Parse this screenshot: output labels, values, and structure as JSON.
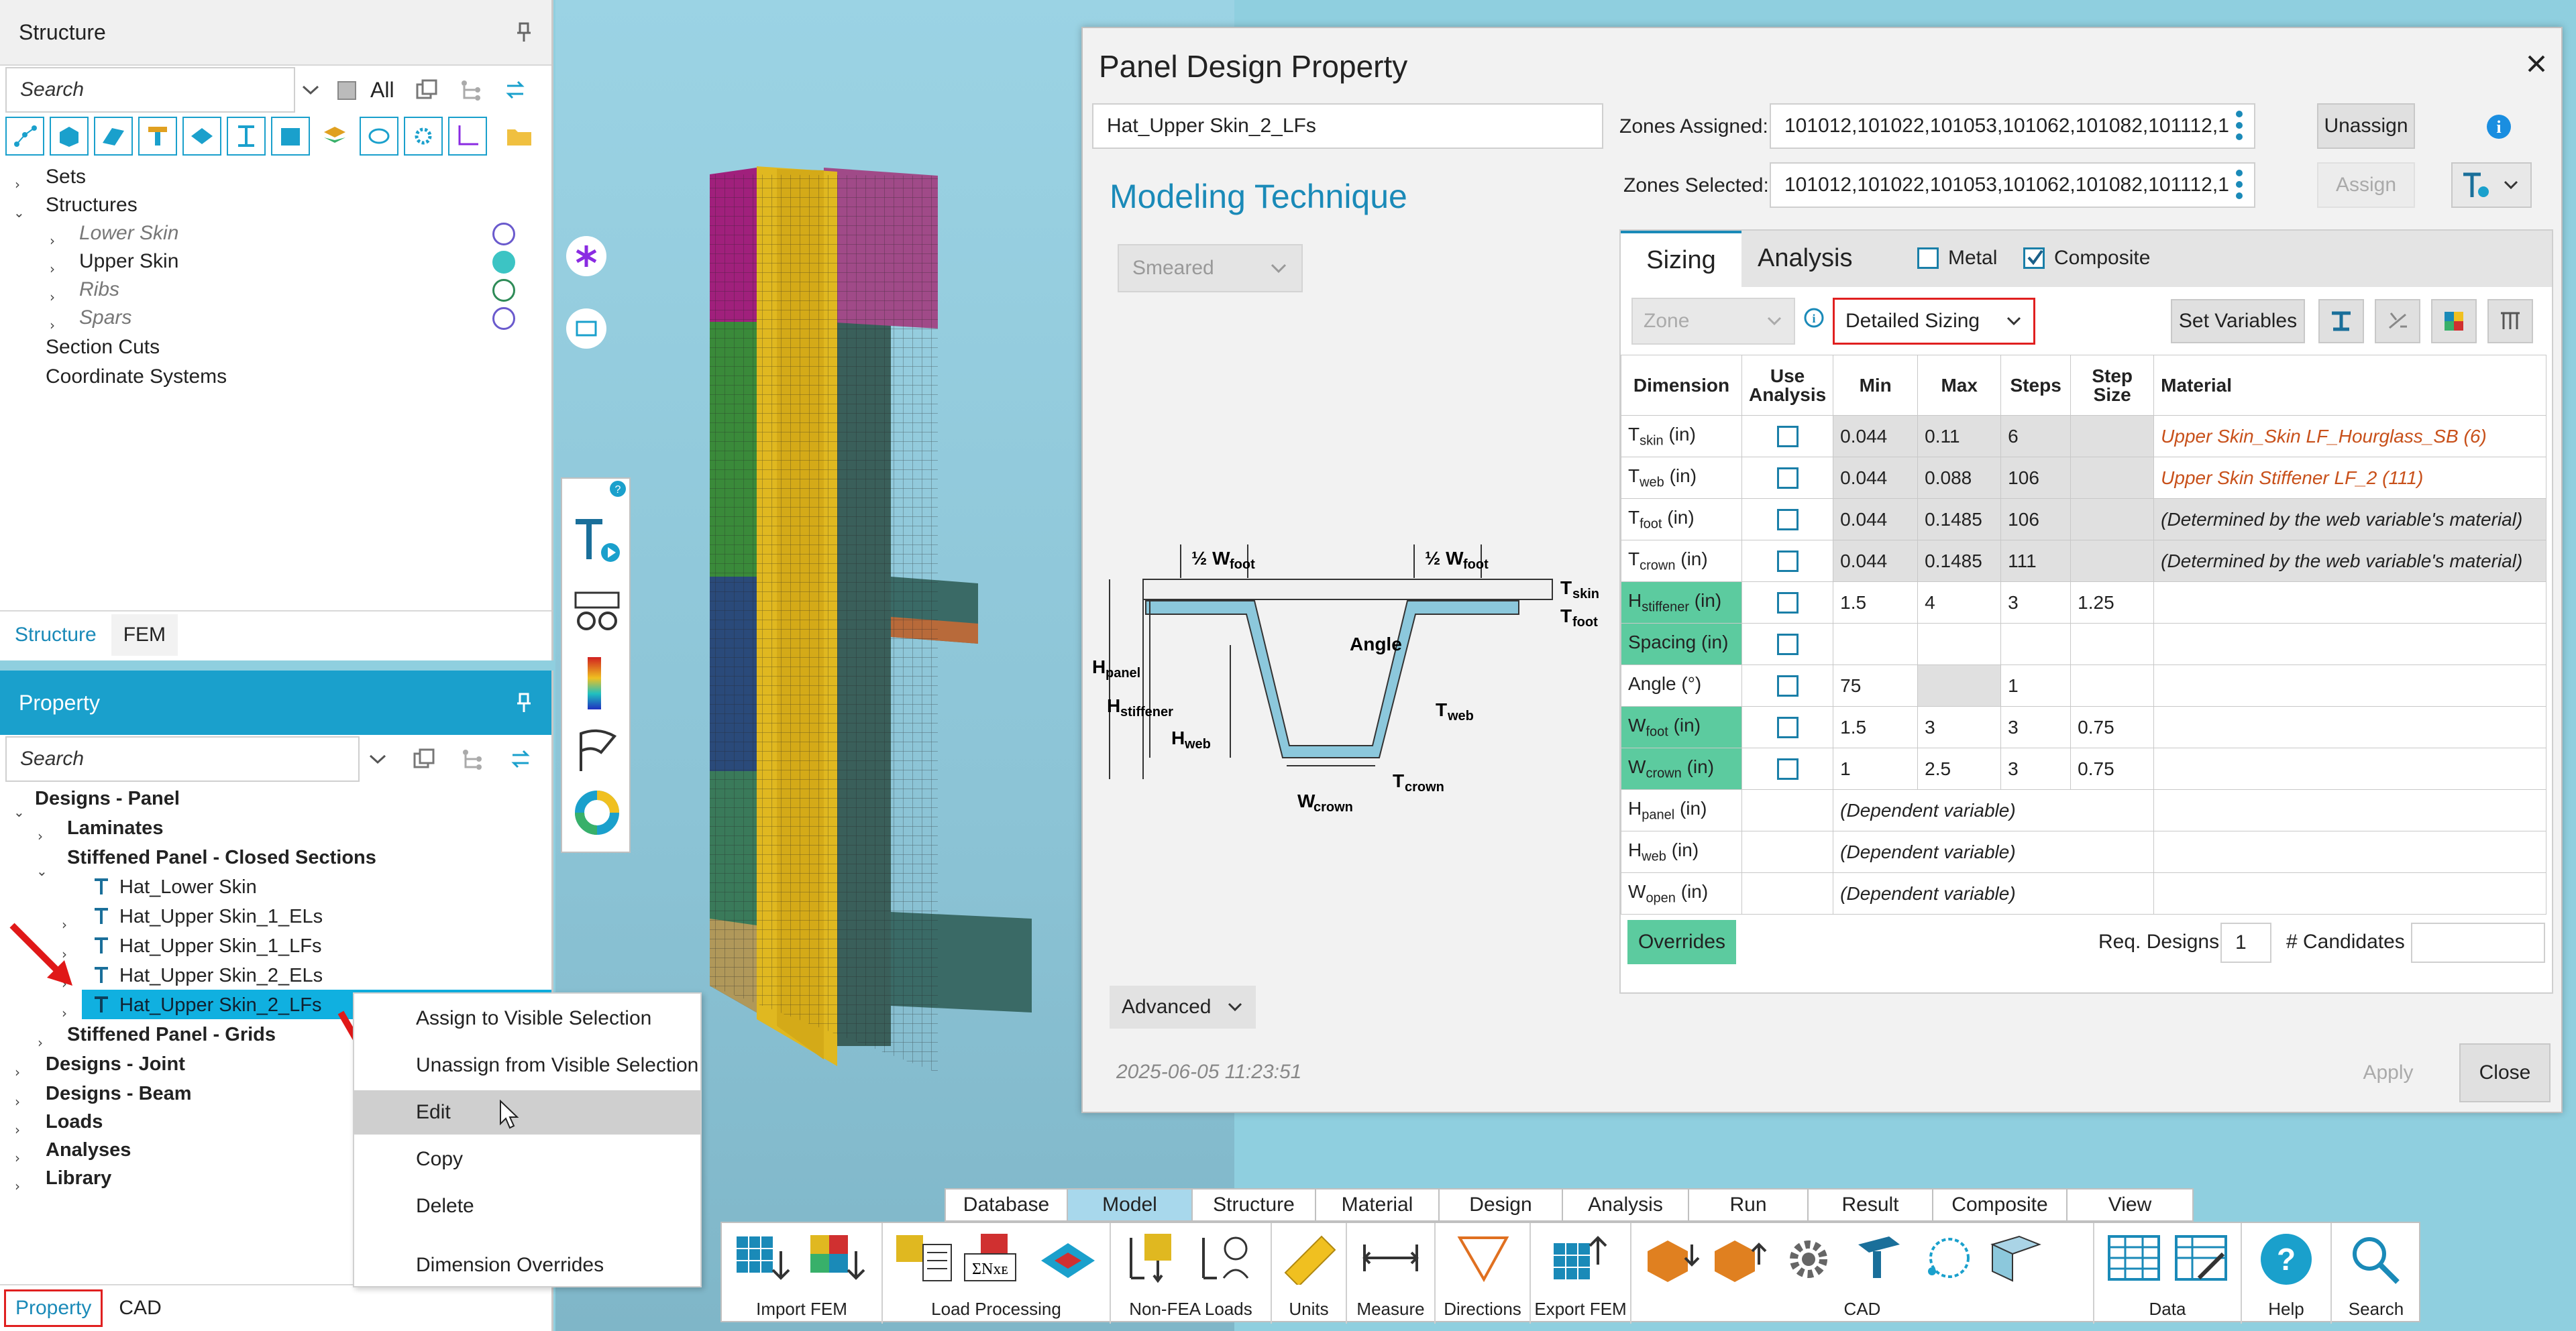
{
  "structure_panel": {
    "title": "Structure",
    "search_placeholder": "Search",
    "all_label": "All",
    "tree": {
      "sets": "Sets",
      "structures": "Structures",
      "lower_skin": "Lower Skin",
      "upper_skin": "Upper Skin",
      "ribs": "Ribs",
      "spars": "Spars",
      "section_cuts": "Section Cuts",
      "coordinate_systems": "Coordinate Systems"
    },
    "tabs": [
      "Structure",
      "FEM"
    ]
  },
  "property_panel": {
    "title": "Property",
    "search_placeholder": "Search",
    "tree": {
      "designs_panel": "Designs - Panel",
      "laminates": "Laminates",
      "stiffened_closed": "Stiffened Panel - Closed Sections",
      "hat_lower_skin": "Hat_Lower Skin",
      "hat_upper_1_els": "Hat_Upper Skin_1_ELs",
      "hat_upper_1_lfs": "Hat_Upper Skin_1_LFs",
      "hat_upper_2_els": "Hat_Upper Skin_2_ELs",
      "hat_upper_2_lfs": "Hat_Upper Skin_2_LFs",
      "stiffened_grids": "Stiffened Panel - Grids",
      "designs_joint": "Designs - Joint",
      "designs_beam": "Designs - Beam",
      "loads": "Loads",
      "analyses": "Analyses",
      "library": "Library"
    },
    "tabs": [
      "Property",
      "CAD"
    ]
  },
  "context_menu": {
    "items": [
      "Assign to Visible Selection",
      "Unassign from Visible Selection",
      "Edit",
      "Copy",
      "Delete",
      "Dimension Overrides"
    ]
  },
  "dialog": {
    "title": "Panel Design Property",
    "name_value": "Hat_Upper Skin_2_LFs",
    "modeling_technique_label": "Modeling Technique",
    "technique_value": "Smeared",
    "zones_assigned_label": "Zones Assigned:",
    "zones_assigned_value": "101012,101022,101053,101062,101082,101112,1",
    "zones_selected_label": "Zones Selected:",
    "zones_selected_value": "101012,101022,101053,101062,101082,101112,1",
    "unassign_label": "Unassign",
    "assign_label": "Assign",
    "tab_sizing": "Sizing",
    "tab_analysis": "Analysis",
    "metal_label": "Metal",
    "composite_label": "Composite",
    "zone_dropdown": "Zone",
    "sizing_dropdown": "Detailed Sizing",
    "set_variables_label": "Set Variables",
    "columns": [
      "Dimension",
      "Use Analysis",
      "Min",
      "Max",
      "Steps",
      "Step Size",
      "Material"
    ],
    "rows": [
      {
        "dim": "T",
        "sub": "skin",
        "unit": " (in)",
        "min": "0.044",
        "max": "0.11",
        "steps": "6",
        "step": "",
        "mat": "Upper Skin_Skin LF_Hourglass_SB (6)"
      },
      {
        "dim": "T",
        "sub": "web",
        "unit": " (in)",
        "min": "0.044",
        "max": "0.088",
        "steps": "106",
        "step": "",
        "mat": "Upper Skin Stiffener LF_2 (111)"
      },
      {
        "dim": "T",
        "sub": "foot",
        "unit": " (in)",
        "min": "0.044",
        "max": "0.1485",
        "steps": "106",
        "step": "",
        "mat": "(Determined by the web variable's material)"
      },
      {
        "dim": "T",
        "sub": "crown",
        "unit": " (in)",
        "min": "0.044",
        "max": "0.1485",
        "steps": "111",
        "step": "",
        "mat": "(Determined by the web variable's material)"
      },
      {
        "dim": "H",
        "sub": "stiffener",
        "unit": " (in)",
        "min": "1.5",
        "max": "4",
        "steps": "3",
        "step": "1.25",
        "mat": ""
      },
      {
        "dim": "Spacing",
        "sub": "",
        "unit": " (in)",
        "min": "",
        "max": "",
        "steps": "",
        "step": "",
        "mat": ""
      },
      {
        "dim": "Angle",
        "sub": "",
        "unit": " (°)",
        "min": "75",
        "max": "",
        "steps": "1",
        "step": "",
        "mat": ""
      },
      {
        "dim": "W",
        "sub": "foot",
        "unit": " (in)",
        "min": "1.5",
        "max": "3",
        "steps": "3",
        "step": "0.75",
        "mat": ""
      },
      {
        "dim": "W",
        "sub": "crown",
        "unit": " (in)",
        "min": "1",
        "max": "2.5",
        "steps": "3",
        "step": "0.75",
        "mat": ""
      },
      {
        "dim": "H",
        "sub": "panel",
        "unit": " (in)",
        "dep": "(Dependent variable)"
      },
      {
        "dim": "H",
        "sub": "web",
        "unit": " (in)",
        "dep": "(Dependent variable)"
      },
      {
        "dim": "W",
        "sub": "open",
        "unit": " (in)",
        "dep": "(Dependent variable)"
      }
    ],
    "overrides_label": "Overrides",
    "req_designs_label": "Req. Designs",
    "req_designs_value": "1",
    "candidates_label": "# Candidates",
    "advanced_label": "Advanced",
    "timestamp": "2025-06-05 11:23:51",
    "apply_label": "Apply",
    "close_label": "Close",
    "diagram": {
      "half_wfoot_left": "½ W",
      "half_wfoot_right": "½ W",
      "foot": "foot",
      "tskin": "T",
      "skin": "skin",
      "tfoot": "T",
      "angle": "Angle",
      "hpanel": "H",
      "panel": "panel",
      "hstiffener": "H",
      "stiffener": "stiffener",
      "hweb": "H",
      "web": "web",
      "tweb": "T",
      "tcrown": "T",
      "crown": "crown",
      "wcrown": "W"
    }
  },
  "menubar": [
    "Database",
    "Model",
    "Structure",
    "Material",
    "Design",
    "Analysis",
    "Run",
    "Result",
    "Composite",
    "View"
  ],
  "ribbon_groups": [
    "Import FEM",
    "Load Processing",
    "Non-FEA Loads",
    "Units",
    "Measure",
    "Directions",
    "Export FEM",
    "CAD",
    "Data",
    "Help",
    "Search"
  ]
}
